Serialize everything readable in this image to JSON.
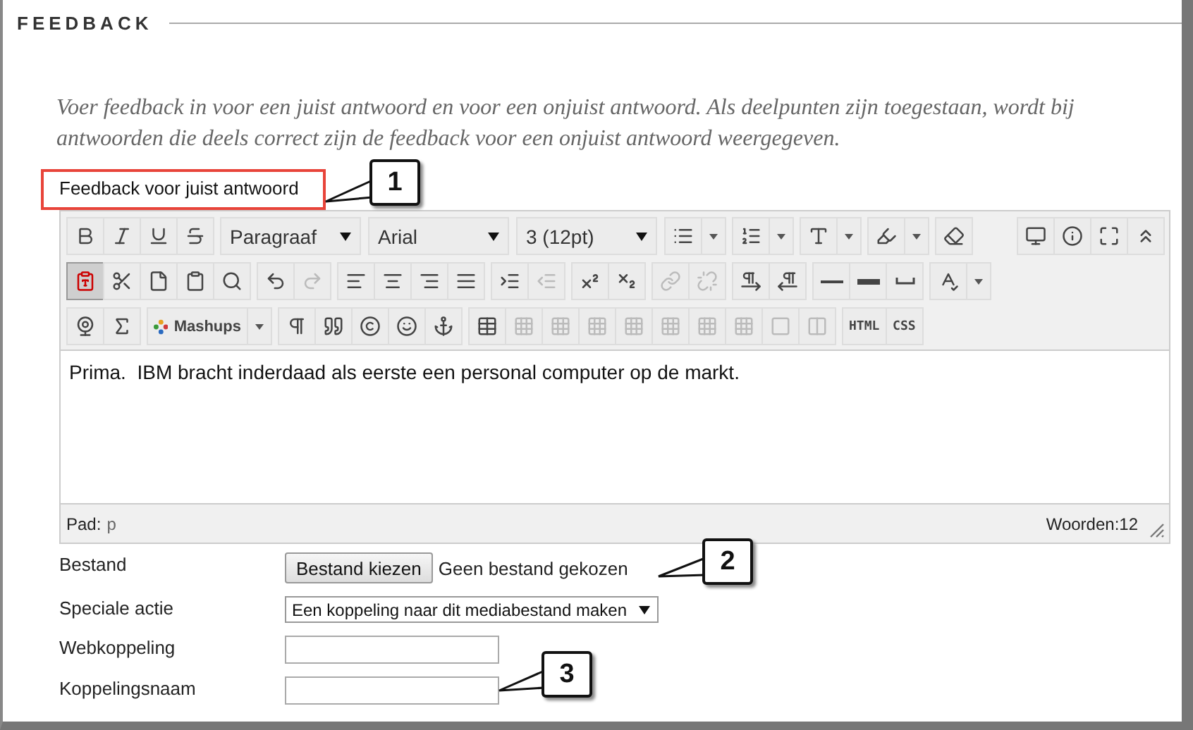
{
  "section": {
    "title": "FEEDBACK"
  },
  "instructions": "Voer feedback in voor een juist antwoord en voor een onjuist antwoord. Als deelpunten zijn toegestaan, wordt bij antwoorden die deels correct zijn de feedback voor een onjuist antwoord weergegeven.",
  "field_label": "Feedback voor juist antwoord",
  "toolbar": {
    "rows": [
      {
        "groups": [
          {
            "items": [
              {
                "kind": "bold"
              },
              {
                "kind": "italic"
              },
              {
                "kind": "underline"
              },
              {
                "kind": "strike"
              }
            ]
          },
          {
            "items": [
              {
                "kind": "select",
                "label": "Paragraaf"
              }
            ]
          },
          {
            "items": [
              {
                "kind": "select",
                "label": "Arial"
              }
            ]
          },
          {
            "items": [
              {
                "kind": "select",
                "label": "3 (12pt)"
              }
            ]
          },
          {
            "items": [
              {
                "kind": "bullets",
                "has_menu": true
              }
            ]
          },
          {
            "items": [
              {
                "kind": "numbers",
                "has_menu": true
              }
            ]
          },
          {
            "items": [
              {
                "kind": "text-color",
                "has_menu": true
              }
            ]
          },
          {
            "items": [
              {
                "kind": "highlight",
                "has_menu": true
              }
            ]
          },
          {
            "items": [
              {
                "kind": "eraser"
              }
            ]
          },
          {
            "items": [
              {
                "kind": "preview"
              },
              {
                "kind": "info"
              },
              {
                "kind": "fullscreen"
              },
              {
                "kind": "collapse"
              }
            ]
          }
        ]
      },
      {
        "groups": [
          {
            "items": [
              {
                "kind": "paste-text",
                "active": true
              },
              {
                "kind": "cut"
              },
              {
                "kind": "copy"
              },
              {
                "kind": "paste"
              },
              {
                "kind": "find"
              }
            ]
          },
          {
            "items": [
              {
                "kind": "undo"
              },
              {
                "kind": "redo",
                "disabled": true
              }
            ]
          },
          {
            "items": [
              {
                "kind": "align-left"
              },
              {
                "kind": "align-center"
              },
              {
                "kind": "align-right"
              },
              {
                "kind": "align-justify"
              }
            ]
          },
          {
            "items": [
              {
                "kind": "indent"
              },
              {
                "kind": "outdent",
                "disabled": true
              }
            ]
          },
          {
            "items": [
              {
                "kind": "superscript"
              },
              {
                "kind": "subscript"
              }
            ]
          },
          {
            "items": [
              {
                "kind": "link",
                "disabled": true
              },
              {
                "kind": "unlink",
                "disabled": true
              }
            ]
          },
          {
            "items": [
              {
                "kind": "ltr"
              },
              {
                "kind": "rtl"
              }
            ]
          },
          {
            "items": [
              {
                "kind": "rule"
              },
              {
                "kind": "thick-rule"
              },
              {
                "kind": "space"
              }
            ]
          },
          {
            "items": [
              {
                "kind": "spellcheck",
                "has_menu": true
              }
            ]
          }
        ]
      },
      {
        "groups": [
          {
            "items": [
              {
                "kind": "webcam"
              },
              {
                "kind": "formula"
              }
            ]
          },
          {
            "items": [
              {
                "kind": "mashups",
                "label": "Mashups",
                "has_menu": true
              }
            ]
          },
          {
            "items": [
              {
                "kind": "pilcrow"
              },
              {
                "kind": "quote"
              },
              {
                "kind": "copyright"
              },
              {
                "kind": "smiley"
              },
              {
                "kind": "anchor"
              }
            ]
          },
          {
            "items": [
              {
                "kind": "table"
              },
              {
                "kind": "table-op",
                "disabled": true
              },
              {
                "kind": "table-op",
                "disabled": true
              },
              {
                "kind": "table-op",
                "disabled": true
              },
              {
                "kind": "table-op",
                "disabled": true
              },
              {
                "kind": "table-op",
                "disabled": true
              },
              {
                "kind": "table-op",
                "disabled": true
              },
              {
                "kind": "table-op",
                "disabled": true
              },
              {
                "kind": "cell",
                "disabled": true
              },
              {
                "kind": "split-cell",
                "disabled": true
              }
            ]
          },
          {
            "items": [
              {
                "kind": "text",
                "label": "HTML"
              },
              {
                "kind": "text",
                "label": "CSS"
              }
            ]
          }
        ]
      }
    ]
  },
  "editor": {
    "content": "Prima.  IBM bracht inderdaad als eerste een personal computer op de markt."
  },
  "status_bar": {
    "path_label": "Pad:",
    "path": "p",
    "word_count": "Woorden:12"
  },
  "form": [
    {
      "label": "Bestand",
      "kind": "file",
      "button": "Bestand kiezen",
      "status": "Geen bestand gekozen"
    },
    {
      "label": "Speciale actie",
      "kind": "select",
      "value": "Een koppeling naar dit mediabestand maken"
    },
    {
      "label": "Webkoppeling",
      "kind": "input"
    },
    {
      "label": "Koppelingsnaam",
      "kind": "input"
    }
  ],
  "callouts": [
    {
      "number": "1"
    },
    {
      "number": "2"
    },
    {
      "number": "3"
    }
  ]
}
